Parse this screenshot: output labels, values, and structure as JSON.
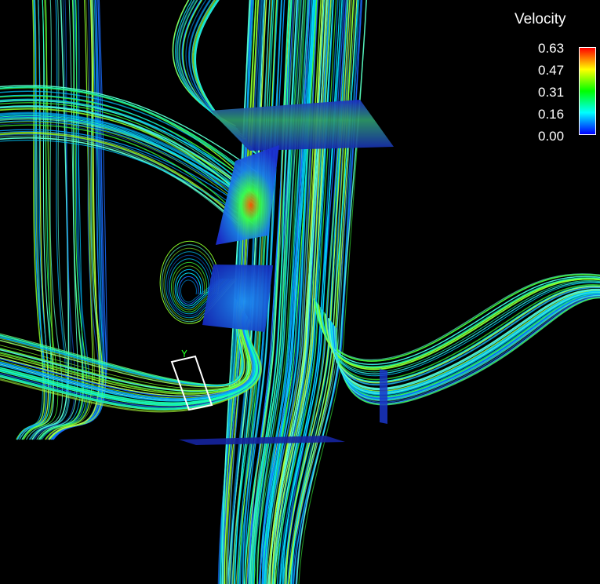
{
  "legend": {
    "title": "Velocity",
    "ticks": [
      "0.63",
      "0.47",
      "0.31",
      "0.16",
      "0.00"
    ],
    "colors": [
      "#ff0000",
      "#ffff00",
      "#00ff00",
      "#00ffff",
      "#0000ff"
    ]
  },
  "scene": {
    "background": "#000000",
    "slice_color": "#1f3bd6",
    "marker_color": "#ffffff",
    "axis_marker_color": "#20ff20"
  }
}
